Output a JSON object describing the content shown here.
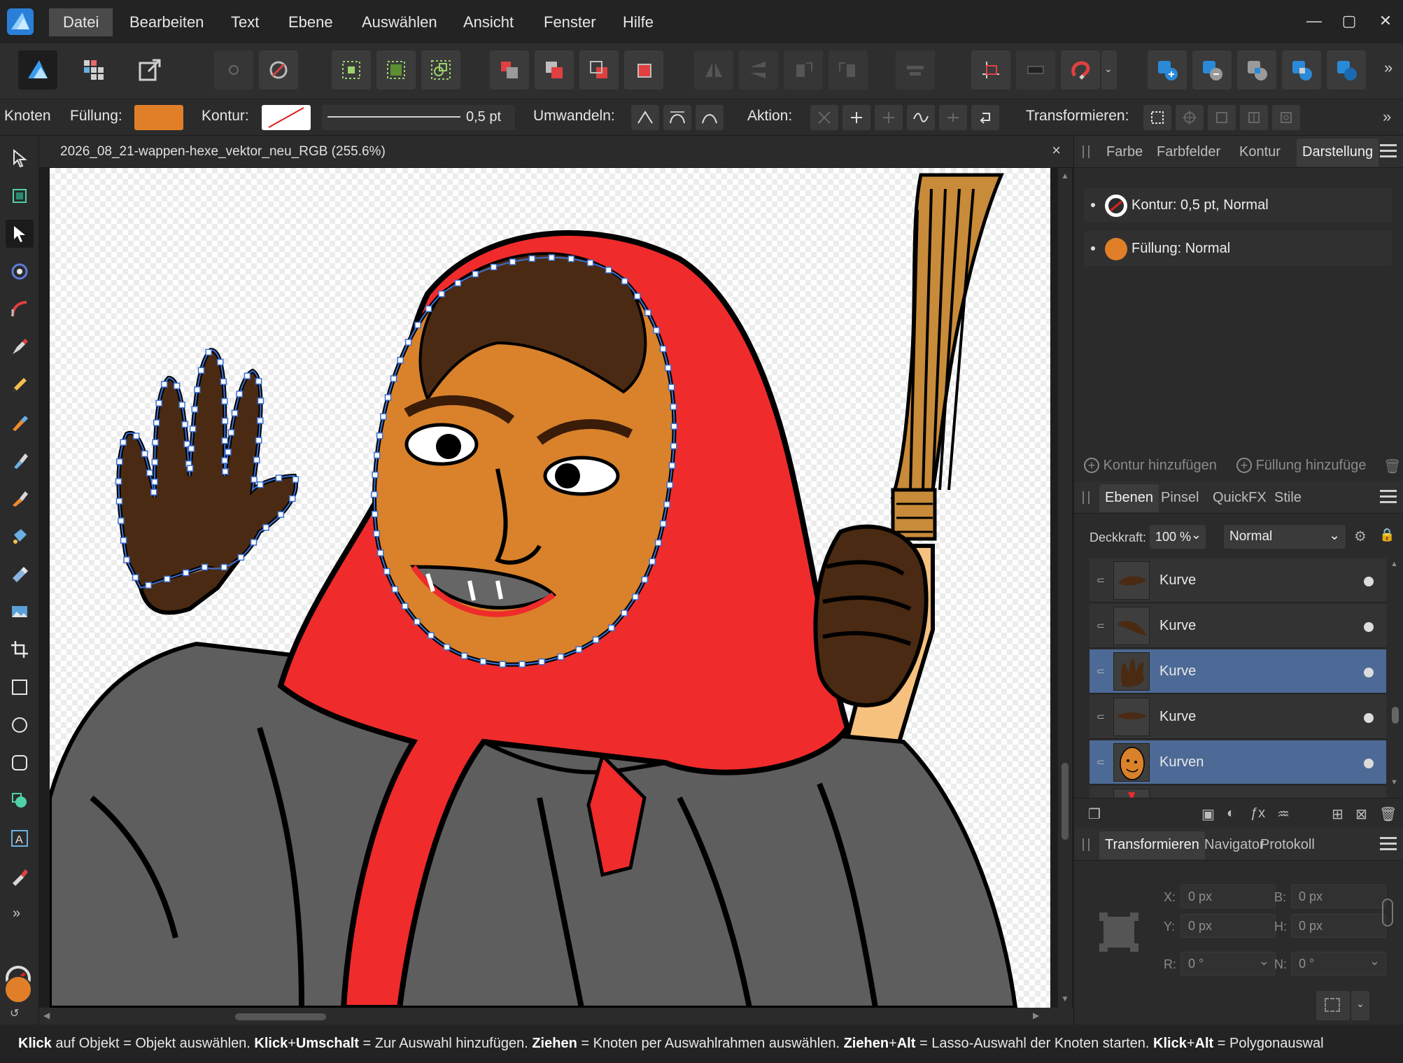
{
  "menu": {
    "items": [
      "Datei",
      "Bearbeiten",
      "Text",
      "Ebene",
      "Auswählen",
      "Ansicht",
      "Fenster",
      "Hilfe"
    ],
    "active": "Datei"
  },
  "context": {
    "tool_name": "Knoten",
    "fill_label": "Füllung:",
    "fill_color": "#e07f28",
    "stroke_label": "Kontur:",
    "stroke_width": "0,5 pt",
    "convert_label": "Umwandeln:",
    "action_label": "Aktion:",
    "transform_label": "Transformieren:"
  },
  "document": {
    "title": "2026_08_21-wappen-hexe_vektor_neu_RGB (255.6%)",
    "close": "×"
  },
  "appearance": {
    "tabs": [
      "Farbe",
      "Farbfelder",
      "Kontur",
      "Darstellung"
    ],
    "active_tab": "Darstellung",
    "stroke_row": "Kontur: 0,5 pt,  Normal",
    "fill_row": "Füllung:  Normal",
    "add_stroke": "Kontur hinzufügen",
    "add_fill": "Füllung hinzufüge"
  },
  "layers": {
    "tabs": [
      "Ebenen",
      "Pinsel",
      "QuickFX",
      "Stile"
    ],
    "active_tab": "Ebenen",
    "opacity_label": "Deckkraft:",
    "opacity_value": "100 %",
    "blend_mode": "Normal",
    "rows": [
      {
        "name": "Kurve",
        "selected": false
      },
      {
        "name": "Kurve",
        "selected": false
      },
      {
        "name": "Kurve",
        "selected": true
      },
      {
        "name": "Kurve",
        "selected": false
      },
      {
        "name": "Kurven",
        "selected": true
      }
    ]
  },
  "transform": {
    "tabs": [
      "Transformieren",
      "Navigator",
      "Protokoll"
    ],
    "active_tab": "Transformieren",
    "x_label": "X:",
    "x_value": "0 px",
    "y_label": "Y:",
    "y_value": "0 px",
    "b_label": "B:",
    "b_value": "0 px",
    "h_label": "H:",
    "h_value": "0 px",
    "r_label": "R:",
    "r_value": "0 °",
    "n_label": "N:",
    "n_value": "0 °"
  },
  "status": {
    "k1": "Klick",
    "t1": " auf Objekt = Objekt auswählen. ",
    "k2": "Klick",
    "p2": "+",
    "k2b": "Umschalt",
    "t2": " = Zur Auswahl hinzufügen. ",
    "k3": "Ziehen",
    "t3": " = Knoten per Auswahlrahmen auswählen. ",
    "k4": "Ziehen",
    "p4": "+",
    "k4b": "Alt",
    "t4": " = Lasso-Auswahl der Knoten starten. ",
    "k5": "Klick",
    "p5": "+",
    "k5b": "Alt",
    "t5": " = Polygonauswal"
  },
  "colors": {
    "accent_blue": "#4d6a96",
    "hood_red": "#ef2b2b",
    "skin_orange": "#d9822b",
    "hand_brown": "#4a2a12",
    "robe_gray": "#5e5e5e",
    "broom_tan": "#c88b3a"
  }
}
